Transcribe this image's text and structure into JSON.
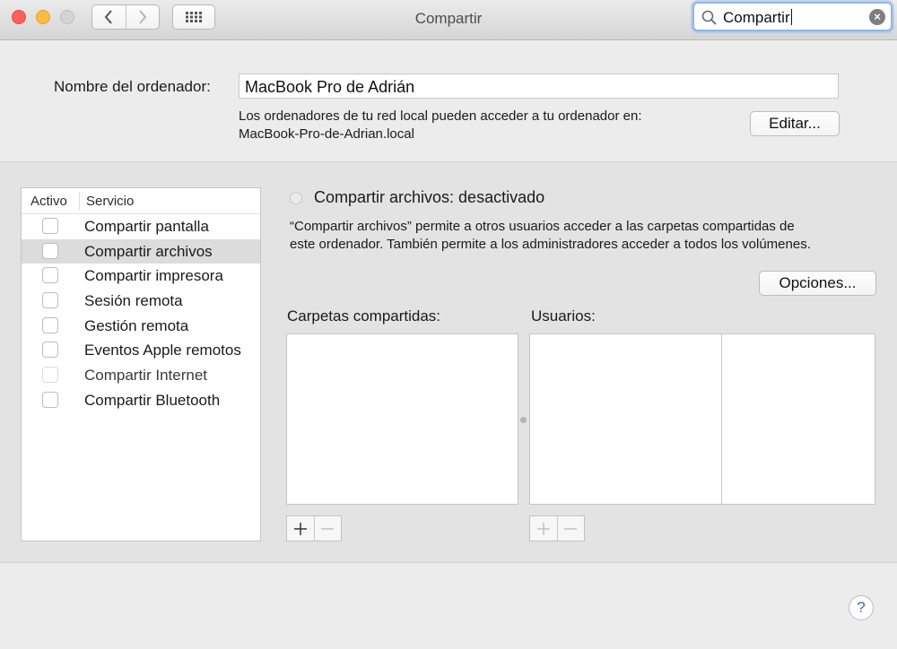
{
  "window": {
    "title": "Compartir"
  },
  "search": {
    "value": "Compartir"
  },
  "computer_name": {
    "label": "Nombre del ordenador:",
    "value": "MacBook Pro de Adrián",
    "description_line1": "Los ordenadores de tu red local pueden acceder a tu ordenador en:",
    "description_line2": "MacBook-Pro-de-Adrian.local",
    "edit_button": "Editar..."
  },
  "services": {
    "header_active": "Activo",
    "header_service": "Servicio",
    "items": [
      {
        "label": "Compartir pantalla",
        "checked": false
      },
      {
        "label": "Compartir archivos",
        "checked": false,
        "selected": true
      },
      {
        "label": "Compartir impresora",
        "checked": false
      },
      {
        "label": "Sesión remota",
        "checked": false
      },
      {
        "label": "Gestión remota",
        "checked": false
      },
      {
        "label": "Eventos Apple remotos",
        "checked": false
      },
      {
        "label": "Compartir Internet",
        "checked": false,
        "disabled": true
      },
      {
        "label": "Compartir Bluetooth",
        "checked": false
      }
    ]
  },
  "detail": {
    "status": "Compartir archivos: desactivado",
    "description_line1": "“Compartir archivos” permite a otros usuarios acceder a las carpetas compartidas de",
    "description_line2": "este ordenador. También permite a los administradores acceder a todos los volúmenes.",
    "options_button": "Opciones...",
    "shared_folders_label": "Carpetas compartidas:",
    "users_label": "Usuarios:"
  },
  "help": {
    "label": "?"
  }
}
